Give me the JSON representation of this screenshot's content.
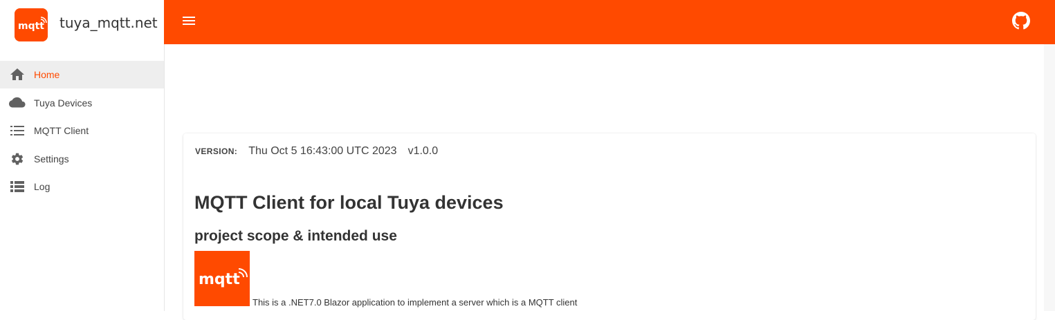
{
  "app": {
    "title": "tuya_mqtt.net",
    "logo_text": "mqtt"
  },
  "colors": {
    "accent": "#ff4a00",
    "active_nav_bg": "#eeeeee",
    "text": "#424242"
  },
  "sidebar": {
    "items": [
      {
        "label": "Home",
        "icon": "home-icon",
        "active": true
      },
      {
        "label": "Tuya Devices",
        "icon": "cloud-icon",
        "active": false
      },
      {
        "label": "MQTT Client",
        "icon": "list-icon",
        "active": false
      },
      {
        "label": "Settings",
        "icon": "gear-icon",
        "active": false
      },
      {
        "label": "Log",
        "icon": "log-list-icon",
        "active": false
      }
    ]
  },
  "topbar": {
    "menu_icon": "hamburger-menu-icon",
    "github_icon": "github-icon"
  },
  "card": {
    "version_label": "VERSION:",
    "version_date": "Thu Oct 5 16:43:00 UTC 2023",
    "version_number": "v1.0.0",
    "heading": "MQTT Client for local Tuya devices",
    "subheading": "project scope & intended use",
    "logo_text": "mqtt",
    "description": "This is a .NET7.0 Blazor application to implement a server which is a MQTT client"
  }
}
